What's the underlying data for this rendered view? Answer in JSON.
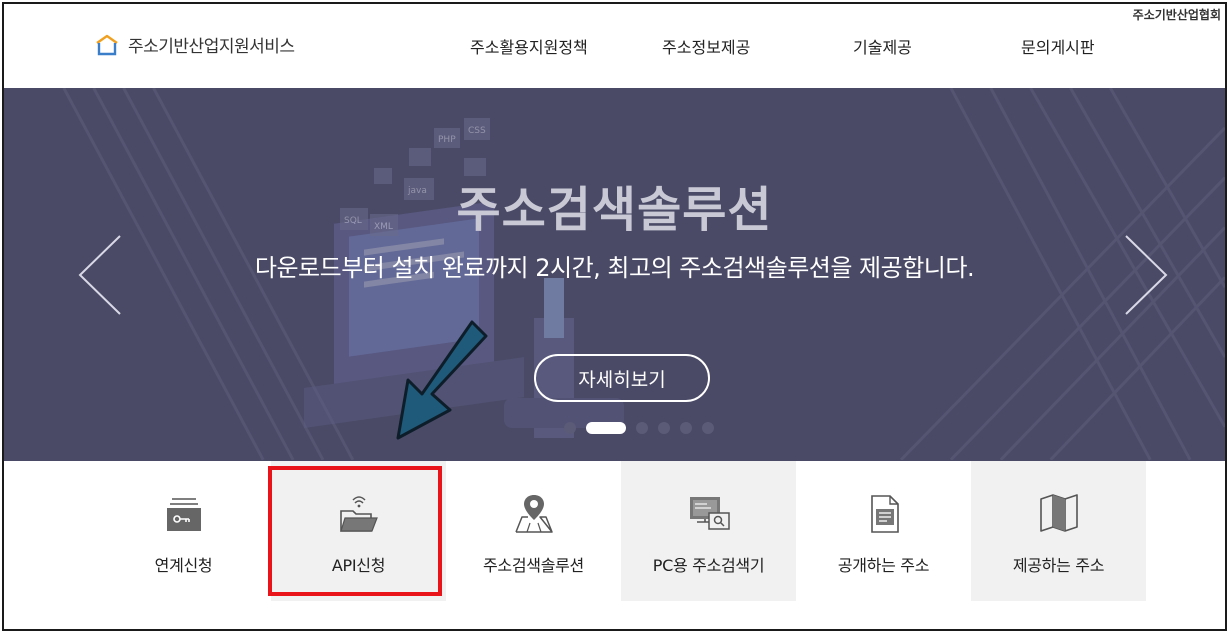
{
  "header": {
    "org_link": "주소기반산업협회",
    "logo_text": "주소기반산업지원서비스",
    "nav": [
      {
        "label": "주소활용지원정책"
      },
      {
        "label": "주소정보제공"
      },
      {
        "label": "기술제공"
      },
      {
        "label": "문의게시판"
      }
    ]
  },
  "hero": {
    "title": "주소검색솔루션",
    "subtitle": "다운로드부터 설치 완료까지 2시간, 최고의 주소검색솔루션을 제공합니다.",
    "button": "자세히보기",
    "illustration_tags": [
      "PHP",
      "CSS",
      "java",
      "SQL",
      "XML"
    ],
    "slide_count": 6,
    "active_slide": 2
  },
  "quick_menu": [
    {
      "label": "연계신청",
      "icon": "key-folder-icon"
    },
    {
      "label": "API신청",
      "icon": "api-folder-icon"
    },
    {
      "label": "주소검색솔루션",
      "icon": "map-pin-icon"
    },
    {
      "label": "PC용 주소검색기",
      "icon": "pc-search-icon"
    },
    {
      "label": "공개하는 주소",
      "icon": "document-icon"
    },
    {
      "label": "제공하는 주소",
      "icon": "map-icon"
    }
  ],
  "colors": {
    "hero_bg": "#4a4a67",
    "highlight": "#e8141a",
    "annotation_arrow": "#1f5a7a"
  }
}
